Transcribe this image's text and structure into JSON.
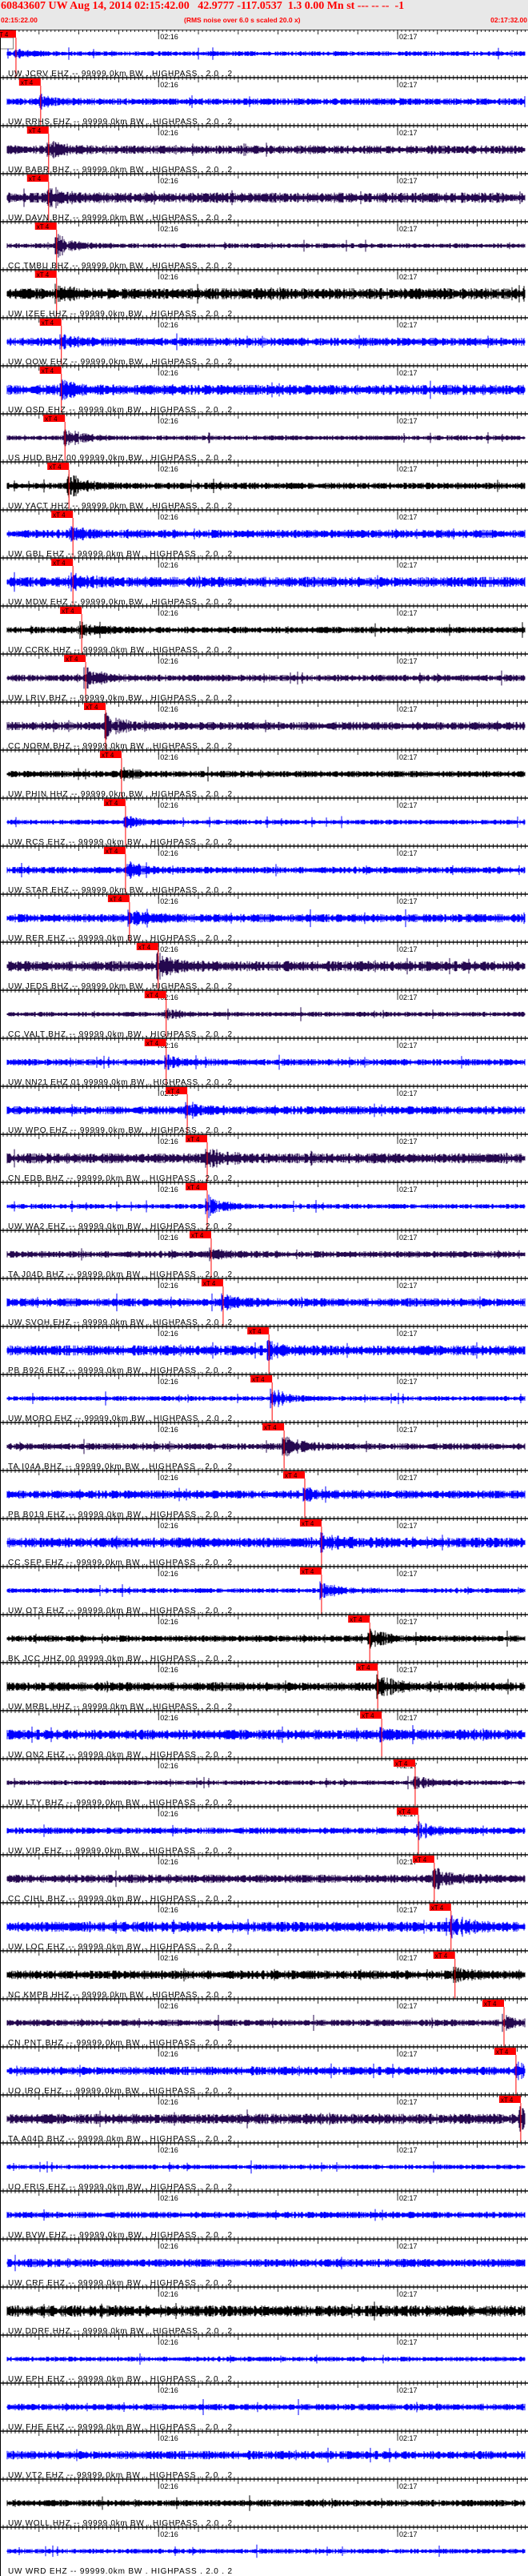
{
  "header": {
    "title": "60843607 UW Aug 14, 2014 02:15:42.00   42.9777 -117.0537  1.3 0.00 Mn st --- -- --  -1",
    "start_time": "02:15:22.00",
    "note": "(RMS noise over 6.0 s scaled 20.0 x)",
    "end_time": "02:17:32.00",
    "top_marker": "T 4"
  },
  "colors": {
    "blue": "#0000ff",
    "purple": "#24084f",
    "black": "#000000",
    "pick": "#ff0000",
    "header_bg": "#e8e8e8"
  },
  "chart_data": {
    "type": "line",
    "title": "60843607 UW Aug 14, 2014 02:15:42.00",
    "x_range_seconds": [
      0,
      130
    ],
    "x_start_label": "02:15:22.00",
    "x_end_label": "02:17:32.00",
    "time_ticks": [
      {
        "label": "02:16",
        "t": 38
      },
      {
        "label": "02:17",
        "t": 98
      }
    ],
    "minor_tick_seconds": 1,
    "major_tick_seconds": 10,
    "pick_label": "xT 4",
    "traces": [
      {
        "label": "UW JCRV EHZ -- 99999.0km BW . HIGHPASS . 2.0 . 2",
        "color": "blue",
        "pick": 2.2
      },
      {
        "label": "UW RRHS EHZ -- 99999.0km BW . HIGHPASS . 2.0 . 2",
        "color": "blue",
        "pick": 8.4
      },
      {
        "label": "UW BABR BHZ -- 99999.0km BW . HIGHPASS . 2.0 . 2",
        "color": "purple",
        "pick": 10.4
      },
      {
        "label": "UW DAVN BHZ -- 99999.0km BW . HIGHPASS . 2.0 . 2",
        "color": "purple",
        "pick": 10.4
      },
      {
        "label": "CC TMBU BHZ -- 99999.0km BW . HIGHPASS . 2.0 . 2",
        "color": "purple",
        "pick": 12.4
      },
      {
        "label": "UW IZEE HHZ -- 99999.0km BW . HIGHPASS . 2.0 . 2",
        "color": "black",
        "pick": 12.4
      },
      {
        "label": "UW OOW EHZ -- 99999.0km BW . HIGHPASS . 2.0 . 2",
        "color": "blue",
        "pick": 13.6
      },
      {
        "label": "UW OSD EHZ -- 99999.0km BW . HIGHPASS . 2.0 . 2",
        "color": "blue",
        "pick": 13.6
      },
      {
        "label": "US HUD BHZ 00 99999.0km BW . HIGHPASS . 2.0 . 2",
        "color": "purple",
        "pick": 14.5
      },
      {
        "label": "UW YACT HHZ -- 99999.0km BW . HIGHPASS . 2.0 . 2",
        "color": "black",
        "pick": 15.5
      },
      {
        "label": "UW GBL EHZ -- 99999.0km BW . HIGHPASS . 2.0 . 2",
        "color": "blue",
        "pick": 16.5
      },
      {
        "label": "UW MDW EHZ -- 99999.0km BW . HIGHPASS . 2.0 . 2",
        "color": "blue",
        "pick": 16.5
      },
      {
        "label": "UW CCRK HHZ -- 99999.0km BW . HIGHPASS . 2.0 . 2",
        "color": "black",
        "pick": 18.7
      },
      {
        "label": "UW LRIV BHZ -- 99999.0km BW . HIGHPASS . 2.0 . 2",
        "color": "purple",
        "pick": 19.7
      },
      {
        "label": "CC NORM BHZ -- 99999.0km BW . HIGHPASS . 2.0 . 2",
        "color": "purple",
        "pick": 24.7
      },
      {
        "label": "UW PHIN HHZ -- 99999.0km BW . HIGHPASS . 2.0 . 2",
        "color": "black",
        "pick": 28.7
      },
      {
        "label": "UW RCS EHZ -- 99999.0km BW . HIGHPASS . 2.0 . 2",
        "color": "blue",
        "pick": 29.7
      },
      {
        "label": "UW STAR EHZ -- 99999.0km BW . HIGHPASS . 2.0 . 2",
        "color": "blue",
        "pick": 29.7
      },
      {
        "label": "UW RER EHZ -- 99999.0km BW . HIGHPASS . 2.0 . 2",
        "color": "blue",
        "pick": 30.7
      },
      {
        "label": "UW JEDS BHZ -- 99999.0km BW . HIGHPASS . 2.0 . 2",
        "color": "purple",
        "pick": 37.9
      },
      {
        "label": "CC VALT BHZ -- 99999.0km BW . HIGHPASS . 2.0 . 2",
        "color": "purple",
        "pick": 39.9
      },
      {
        "label": "UW NN21 EHZ 01 99999.0km BW . HIGHPASS . 2.0 . 2",
        "color": "blue",
        "pick": 39.9
      },
      {
        "label": "UW WPO EHZ -- 99999.0km BW . HIGHPASS . 2.0 . 2",
        "color": "blue",
        "pick": 45.2
      },
      {
        "label": "CN EDB BHZ -- 99999.0km BW . HIGHPASS . 2.0 . 2",
        "color": "purple",
        "pick": 50.2
      },
      {
        "label": "UW WA2 EHZ -- 99999.0km BW . HIGHPASS . 2.0 . 2",
        "color": "blue",
        "pick": 50.2
      },
      {
        "label": "TA J04D BHZ -- 99999.0km BW . HIGHPASS . 2.0 . 2",
        "color": "purple",
        "pick": 51.2
      },
      {
        "label": "UW SVOH EHZ -- 99999.0km BW . HIGHPASS . 2.0 . 2",
        "color": "blue",
        "pick": 54.2
      },
      {
        "label": "PB B926 EHZ -- 99999.0km BW . HIGHPASS . 2.0 . 2",
        "color": "blue",
        "pick": 65.7
      },
      {
        "label": "UW MORO EHZ -- 99999.0km BW . HIGHPASS . 2.0 . 2",
        "color": "blue",
        "pick": 66.5
      },
      {
        "label": "TA I04A BHZ -- 99999.0km BW . HIGHPASS . 2.0 . 2",
        "color": "purple",
        "pick": 69.5
      },
      {
        "label": "PB B019 EHZ -- 99999.0km BW . HIGHPASS . 2.0 . 2",
        "color": "blue",
        "pick": 74.7
      },
      {
        "label": "CC SEP EHZ -- 99999.0km BW . HIGHPASS . 2.0 . 2",
        "color": "blue",
        "pick": 78.9
      },
      {
        "label": "UW OT3 EHZ -- 99999.0km BW . HIGHPASS . 2.0 . 2",
        "color": "blue",
        "pick": 78.9
      },
      {
        "label": "BK JCC HHZ 00 99999.0km BW . HIGHPASS . 2.0 . 2",
        "color": "black",
        "pick": 91.0
      },
      {
        "label": "UW MRBL HHZ -- 99999.0km BW . HIGHPASS . 2.0 . 2",
        "color": "black",
        "pick": 93.0
      },
      {
        "label": "UW ON2 EHZ -- 99999.0km BW . HIGHPASS . 2.0 . 2",
        "color": "blue",
        "pick": 94.0
      },
      {
        "label": "UW LTY BHZ -- 99999.0km BW . HIGHPASS . 2.0 . 2",
        "color": "purple",
        "pick": 102.4
      },
      {
        "label": "UW VIP EHZ -- 99999.0km BW . HIGHPASS . 2.0 . 2",
        "color": "blue",
        "pick": 103.2
      },
      {
        "label": "CC CIHL BHZ -- 99999.0km BW . HIGHPASS . 2.0 . 2",
        "color": "purple",
        "pick": 107.2
      },
      {
        "label": "UW LOC EHZ -- 99999.0km BW . HIGHPASS . 2.0 . 2",
        "color": "blue",
        "pick": 111.4
      },
      {
        "label": "NC KMPB HHZ -- 99999.0km BW . HIGHPASS . 2.0 . 2",
        "color": "black",
        "pick": 112.4
      },
      {
        "label": "CN PNT BHZ -- 99999.0km BW . HIGHPASS . 2.0 . 2",
        "color": "purple",
        "pick": 124.7
      },
      {
        "label": "UO IRO EHZ -- 99999.0km BW . HIGHPASS . 2.0 . 2",
        "color": "blue",
        "pick": 127.7
      },
      {
        "label": "TA A04D BHZ -- 99999.0km BW . HIGHPASS . 2.0 . 2",
        "color": "purple",
        "pick": 128.9
      },
      {
        "label": "UO FRIS EHZ -- 99999.0km BW . HIGHPASS . 2.0 . 2",
        "color": "blue",
        "pick": null
      },
      {
        "label": "UW BVW EHZ -- 99999.0km BW . HIGHPASS . 2.0 . 2",
        "color": "blue",
        "pick": null
      },
      {
        "label": "UW CRF EHZ -- 99999.0km BW . HIGHPASS . 2.0 . 2",
        "color": "blue",
        "pick": null
      },
      {
        "label": "UW DDRF HHZ -- 99999.0km BW . HIGHPASS . 2.0 . 2",
        "color": "black",
        "pick": null
      },
      {
        "label": "UW EPH EHZ -- 99999.0km BW . HIGHPASS . 2.0 . 2",
        "color": "blue",
        "pick": null
      },
      {
        "label": "UW FHE EHZ -- 99999.0km BW . HIGHPASS . 2.0 . 2",
        "color": "blue",
        "pick": null
      },
      {
        "label": "UW VT2 EHZ -- 99999.0km BW . HIGHPASS . 2.0 . 2",
        "color": "blue",
        "pick": null
      },
      {
        "label": "UW WOLL HHZ -- 99999.0km BW . HIGHPASS . 2.0 . 2",
        "color": "black",
        "pick": null
      },
      {
        "label": "UW WRD EHZ -- 99999.0km BW . HIGHPASS . 2.0 . 2",
        "color": "blue",
        "pick": null
      }
    ]
  }
}
